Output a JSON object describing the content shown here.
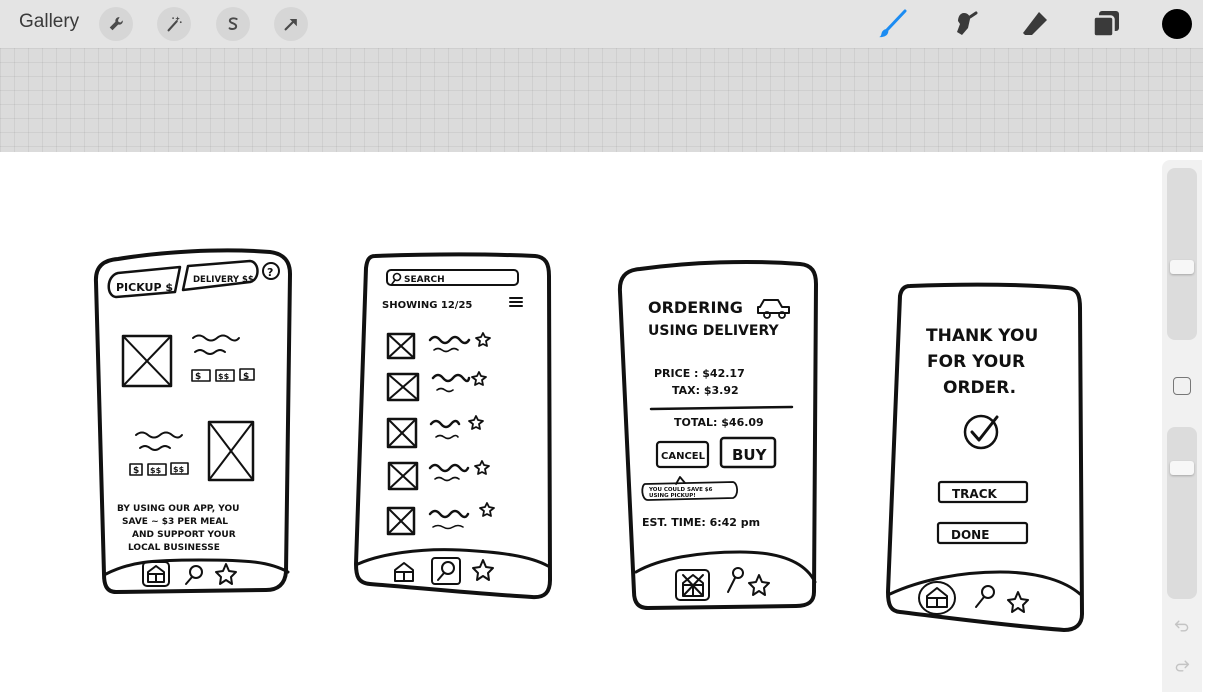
{
  "toolbar": {
    "gallery_label": "Gallery",
    "left_tools": [
      "wrench-icon",
      "magic-wand-icon",
      "selection-icon",
      "transform-arrow-icon"
    ],
    "right_tools": [
      "brush-icon",
      "smudge-icon",
      "eraser-icon",
      "layers-icon"
    ],
    "accent_color": "#1c8cf2",
    "current_color": "#000000"
  },
  "canvas_background": "#ffffff",
  "sketches": {
    "screen1": {
      "pickup_tab": "PICKUP $",
      "delivery_tab": "DELIVERY $$",
      "help": "?",
      "tags_row1": [
        "$",
        "$$",
        "$"
      ],
      "tags_row2": [
        "$",
        "$$",
        "$$"
      ],
      "promo_lines": [
        "BY USING OUR APP, YOU",
        "SAVE ~ $3 PER MEAL",
        "AND SUPPORT YOUR",
        "LOCAL BUSINESSE"
      ]
    },
    "screen2": {
      "search": "SEARCH",
      "showing": "SHOWING 12/25"
    },
    "screen3": {
      "title_line1": "ORDERING",
      "title_line2": "USING DELIVERY",
      "price": "PRICE : $42.17",
      "tax": "TAX: $3.92",
      "total": "TOTAL: $46.09",
      "cancel": "CANCEL",
      "buy": "BUY",
      "tip_line1": "YOU COULD SAVE $6",
      "tip_line2": "USING PICKUP!",
      "est_time": "EST. TIME:  6:42 pm"
    },
    "screen4": {
      "thanks_line1": "THANK YOU",
      "thanks_line2": "FOR YOUR",
      "thanks_line3": "ORDER.",
      "track": "TRACK",
      "done": "DONE"
    }
  },
  "sidebar": {
    "brush_size_level": 0.55,
    "opacity_level": 0.75
  }
}
